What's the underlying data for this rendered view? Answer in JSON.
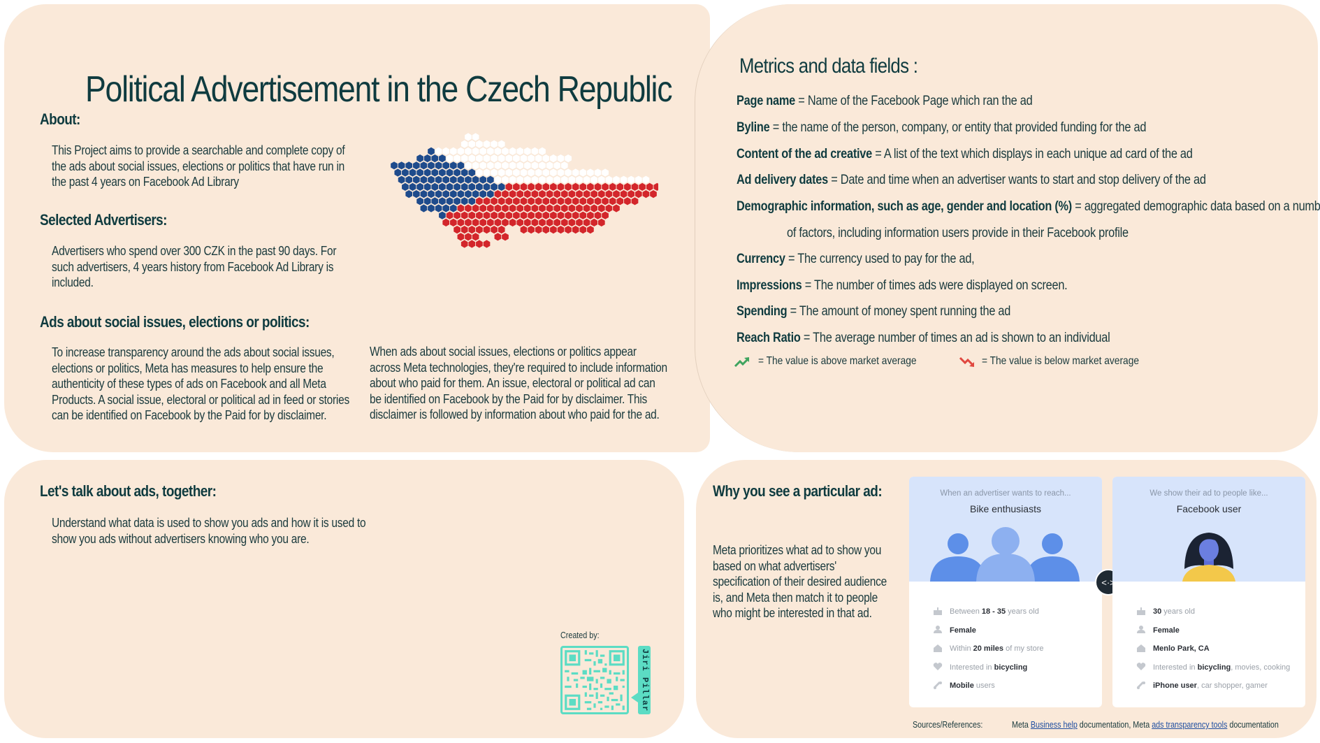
{
  "title": "Political Advertisement in the Czech Republic",
  "about": {
    "heading": "About:",
    "text": "This Project aims to provide a searchable and complete copy of the ads about social issues, elections or politics that have run in the past 4 years on Facebook Ad Library"
  },
  "advertisers": {
    "heading": "Selected Advertisers:",
    "text": "Advertisers who spend over 300 CZK in the past 90 days. For such advertisers, 4 years history from Facebook Ad Library is included."
  },
  "ads_about": {
    "heading": "Ads about social issues, elections or politics:",
    "text_left": "To increase transparency around the ads about social issues, elections or politics, Meta has measures to help ensure the authenticity of these types of ads on Facebook and all Meta Products. A social issue, electoral or political ad in feed or stories can be identified on Facebook by the Paid for by disclaimer.",
    "text_right": "When ads about social issues, elections or politics appear across Meta technologies, they're required to include information about who paid for them. An issue, electoral or political ad can be identified on Facebook by the Paid for by disclaimer. This disclaimer is followed by information about who paid for the ad."
  },
  "metrics": {
    "heading": "Metrics and data fields :",
    "items": [
      {
        "name": "Page name",
        "desc": " = Name of the Facebook Page which ran the ad"
      },
      {
        "name": "Byline",
        "desc": " = the name of the person, company, or entity that provided funding for the ad"
      },
      {
        "name": "Content of the ad creative",
        "desc": " = A list of the text which displays in each unique ad card of the ad"
      },
      {
        "name": "Ad delivery dates",
        "desc": " = Date and time when an advertiser wants to start and  stop delivery of the ad"
      },
      {
        "name": "Demographic information, such as age, gender and location (%)",
        "desc": " = aggregated demographic data based on a number"
      },
      {
        "name": "",
        "desc": "of factors, including information users provide in their Facebook profile"
      },
      {
        "name": "Currency",
        "desc": " = The currency used to pay for the ad,"
      },
      {
        "name": "Impressions",
        "desc": " = The number of times ads were displayed on screen."
      },
      {
        "name": "Spending",
        "desc": " = The amount of money spent running the ad"
      },
      {
        "name": "Reach Ratio",
        "desc": " = The average number of times an ad is shown to an individual"
      }
    ],
    "legend_above": "= The value is above market average",
    "legend_below": "= The value is below market average",
    "color_above": "#3fa45f",
    "color_below": "#e0473f"
  },
  "talk": {
    "heading": "Let's talk about ads, together:",
    "text": "Understand what data is used to show you ads and how it is used to show you ads without advertisers knowing who you are.",
    "created_by": "Created by:",
    "author": "Jiri Pillar"
  },
  "why": {
    "heading": "Why you see a particular ad:",
    "text": "Meta prioritizes what ad to show you based on what advertisers' specification of their desired audience is, and Meta then match it to people who might be interested in that ad.",
    "card_left": {
      "caption": "When an advertiser wants to reach...",
      "label": "Bike enthusiasts",
      "rows": [
        {
          "icon": "cake-icon",
          "pre": "Between ",
          "bold": "18 - 35",
          "post": " years old"
        },
        {
          "icon": "person-icon",
          "pre": "",
          "bold": "Female",
          "post": ""
        },
        {
          "icon": "home-icon",
          "pre": "Within ",
          "bold": "20 miles",
          "post": " of my store"
        },
        {
          "icon": "heart-icon",
          "pre": "Interested in ",
          "bold": "bicycling",
          "post": ""
        },
        {
          "icon": "link-icon",
          "pre": "",
          "bold": "Mobile",
          "post": " users"
        }
      ]
    },
    "card_right": {
      "caption": "We show their ad to people like...",
      "label": "Facebook user",
      "rows": [
        {
          "icon": "cake-icon",
          "pre": "",
          "bold": "30",
          "post": " years old"
        },
        {
          "icon": "person-icon",
          "pre": "",
          "bold": "Female",
          "post": ""
        },
        {
          "icon": "home-icon",
          "pre": "",
          "bold": "Menlo Park, CA",
          "post": ""
        },
        {
          "icon": "heart-icon",
          "pre": "Interested in ",
          "bold": "bicycling",
          "post": ", movies, cooking"
        },
        {
          "icon": "link-icon",
          "pre": "",
          "bold": "iPhone user",
          "post": ", car shopper, gamer"
        }
      ]
    },
    "sources_label": "Sources/References:",
    "sources_pre": "Meta ",
    "sources_link1": "Business help",
    "sources_mid": " documentation, Meta ",
    "sources_link2": "ads transparency tools",
    "sources_post": " documentation"
  },
  "colors": {
    "background": "#fae9d9",
    "heading": "#0f3b3f",
    "map_blue": "#1e4b8c",
    "map_red": "#d3262b",
    "map_white": "#ffffff",
    "qr_accent": "#5cdcc4"
  }
}
